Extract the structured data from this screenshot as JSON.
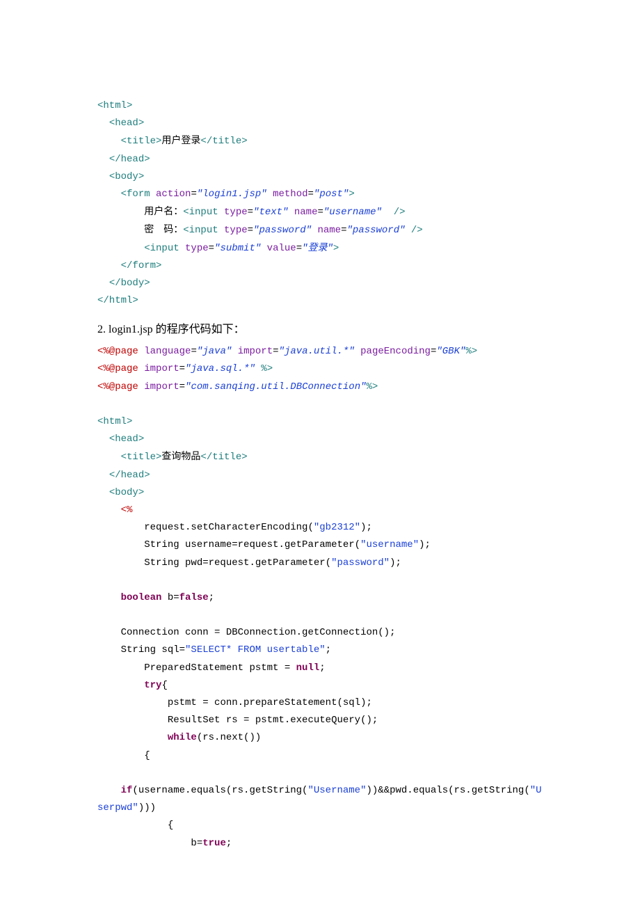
{
  "block1": {
    "l1a": "<html>",
    "l2a": "  <head>",
    "l3a": "    <title>",
    "l3b": "用户登录",
    "l3c": "</title>",
    "l4a": "  </head>",
    "l5a": "  <body>",
    "l6a": "    <form ",
    "l6b": "action",
    "l6c": "=",
    "l6d": "\"login1.jsp\"",
    "l6e": " ",
    "l6f": "method",
    "l6g": "=",
    "l6h": "\"post\"",
    "l6i": ">",
    "l7a": "        ",
    "l7b": "用户名：",
    "l7c": "<input ",
    "l7d": "type",
    "l7e": "=",
    "l7f": "\"text\"",
    "l7g": " ",
    "l7h": "name",
    "l7i": "=",
    "l7j": "\"username\"",
    "l7k": "  />",
    "l8a": "        ",
    "l8b": "密    码：",
    "l8c": "<input ",
    "l8d": "type",
    "l8e": "=",
    "l8f": "\"password\"",
    "l8g": " ",
    "l8h": "name",
    "l8i": "=",
    "l8j": "\"password\"",
    "l8k": " />",
    "l9a": "        <input ",
    "l9b": "type",
    "l9c": "=",
    "l9d": "\"submit\"",
    "l9e": " ",
    "l9f": "value",
    "l9g": "=",
    "l9h": "\"登录\"",
    "l9i": ">",
    "l10a": "    </form>",
    "l11a": "  </body>",
    "l12a": "</html>"
  },
  "heading": "2. login1.jsp 的程序代码如下：",
  "block2": {
    "l1a": "<%@",
    "l1b": "page ",
    "l1c": "language",
    "l1d": "=",
    "l1e": "\"java\"",
    "l1f": " ",
    "l1g": "import",
    "l1h": "=",
    "l1i": "\"java.util.*\"",
    "l1j": " ",
    "l1k": "pageEncoding",
    "l1l": "=",
    "l1m": "\"GBK\"",
    "l1n": "%>",
    "l2a": "<%@",
    "l2b": "page ",
    "l2c": "import",
    "l2d": "=",
    "l2e": "\"java.sql.*\"",
    "l2f": " ",
    "l2g": "%>",
    "l3a": "<%@",
    "l3b": "page ",
    "l3c": "import",
    "l3d": "=",
    "l3e": "\"com.sanqing.util.DBConnection\"",
    "l3f": "%>",
    "l5a": "<html>",
    "l6a": "  <head>",
    "l7a": "    <title>",
    "l7b": "查询物品",
    "l7c": "</title>",
    "l8a": "  </head>",
    "l9a": "  <body>",
    "l10a": "    <%",
    "l11a": "        request.setCharacterEncoding(",
    "l11b": "\"gb2312\"",
    "l11c": ");",
    "l12a": "        String username=request.getParameter(",
    "l12b": "\"username\"",
    "l12c": ");",
    "l13a": "        String pwd=request.getParameter(",
    "l13b": "\"password\"",
    "l13c": ");",
    "l15a": "    ",
    "l15b": "boolean",
    "l15c": " b=",
    "l15d": "false",
    "l15e": ";",
    "l17a": "    Connection conn = DBConnection.getConnection();",
    "l18a": "    String sql=",
    "l18b": "\"SELECT* FROM usertable\"",
    "l18c": ";",
    "l19a": "        PreparedStatement pstmt = ",
    "l19b": "null",
    "l19c": ";",
    "l20a": "        ",
    "l20b": "try",
    "l20c": "{",
    "l21a": "            pstmt = conn.prepareStatement(sql);",
    "l22a": "            ResultSet rs = pstmt.executeQuery();",
    "l23a": "            ",
    "l23b": "while",
    "l23c": "(rs.next())",
    "l24a": "        {",
    "l26a": "    ",
    "l26b": "if",
    "l26c": "(username.equals(rs.getString(",
    "l26d": "\"Username\"",
    "l26e": "))&&pwd.equals(rs.getString(",
    "l26f": "\"Userpwd\"",
    "l26g": ")))",
    "l27a": "            {",
    "l28a": "                b=",
    "l28b": "true",
    "l28c": ";"
  }
}
